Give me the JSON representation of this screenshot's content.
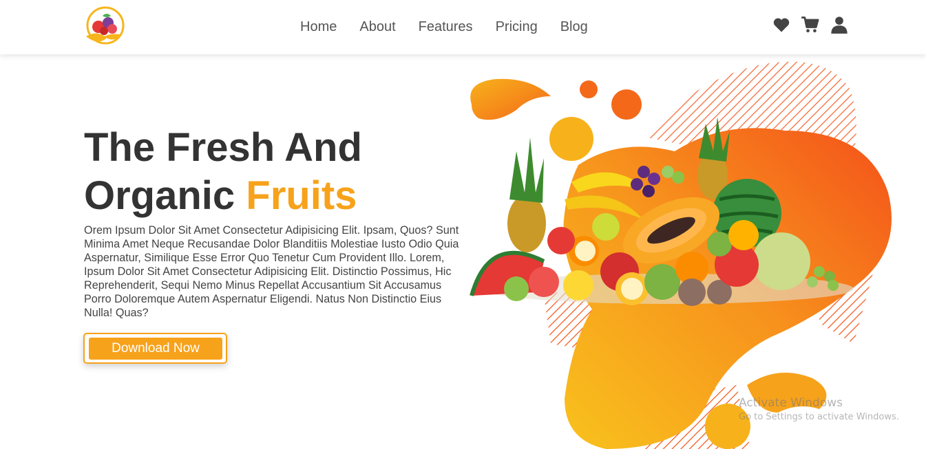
{
  "header": {
    "logo_icon": "fruit-basket-logo",
    "nav": [
      {
        "label": "Home"
      },
      {
        "label": "About"
      },
      {
        "label": "Features"
      },
      {
        "label": "Pricing"
      },
      {
        "label": "Blog"
      }
    ],
    "icons": [
      "heart-icon",
      "cart-icon",
      "user-icon"
    ]
  },
  "hero": {
    "title_line1": "The Fresh And",
    "title_line2_plain": "Organic ",
    "title_line2_accent": "Fruits",
    "body": "Orem Ipsum Dolor Sit Amet Consectetur Adipisicing Elit. Ipsam, Quos? Sunt Minima Amet Neque Recusandae Dolor Blanditiis Molestiae Iusto Odio Quia Aspernatur, Similique Esse Error Quo Tenetur Cum Provident Illo. Lorem, Ipsum Dolor Sit Amet Consectetur Adipisicing Elit. Distinctio Possimus, Hic Reprehenderit, Sequi Nemo Minus Repellat Accusantium Sit Accusamus Porro Doloremque Autem Aspernatur Eligendi. Natus Non Distinctio Eius Nulla! Quas?",
    "cta_label": "Download Now"
  },
  "watermark": {
    "line1": "Activate Windows",
    "line2": "Go to Settings to activate Windows."
  },
  "colors": {
    "accent": "#f7a21b",
    "text_dark": "#333333",
    "orange_deep": "#f4561a"
  }
}
